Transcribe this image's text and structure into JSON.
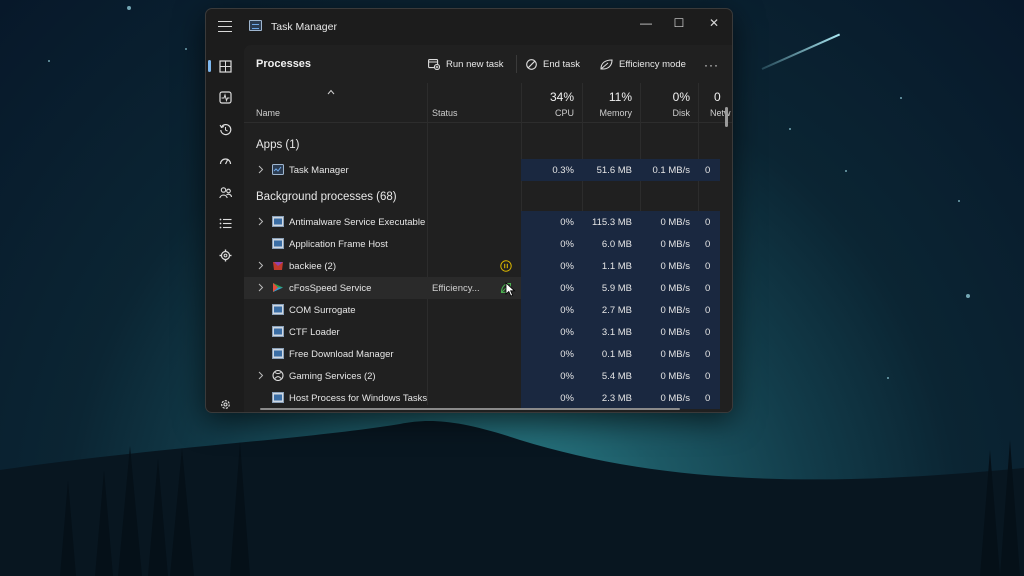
{
  "window": {
    "title": "Task Manager",
    "controls": {
      "minimize": "—",
      "maximize": "☐",
      "close": "✕"
    }
  },
  "sidebar": {
    "items": [
      {
        "icon": "processes-icon",
        "active": true
      },
      {
        "icon": "performance-icon"
      },
      {
        "icon": "app-history-icon"
      },
      {
        "icon": "startup-apps-icon"
      },
      {
        "icon": "users-icon"
      },
      {
        "icon": "details-icon"
      },
      {
        "icon": "services-icon"
      }
    ],
    "settings_icon": "gear-icon"
  },
  "toolbar": {
    "page_title": "Processes",
    "run_new_task": "Run new task",
    "end_task": "End task",
    "efficiency_mode": "Efficiency mode",
    "more": "···"
  },
  "columns": {
    "name": "Name",
    "status": "Status",
    "cpu": {
      "pct": "34%",
      "label": "CPU"
    },
    "memory": {
      "pct": "11%",
      "label": "Memory"
    },
    "disk": {
      "pct": "0%",
      "label": "Disk"
    },
    "network": {
      "pct": "0",
      "label": "Netw"
    }
  },
  "groups": {
    "apps": "Apps (1)",
    "background": "Background processes (68)"
  },
  "apps": [
    {
      "name": "Task Manager",
      "status": "",
      "cpu": "0.3%",
      "memory": "51.6 MB",
      "disk": "0.1 MB/s",
      "network": "0"
    }
  ],
  "background": [
    {
      "name": "Antimalware Service Executable",
      "status": "",
      "cpu": "0%",
      "memory": "115.3 MB",
      "disk": "0 MB/s",
      "network": "0"
    },
    {
      "name": "Application Frame Host",
      "status": "",
      "cpu": "0%",
      "memory": "6.0 MB",
      "disk": "0 MB/s",
      "network": "0"
    },
    {
      "name": "backiee (2)",
      "status": "",
      "cpu": "0%",
      "memory": "1.1 MB",
      "disk": "0 MB/s",
      "network": "0"
    },
    {
      "name": "cFosSpeed Service",
      "status": "Efficiency...",
      "cpu": "0%",
      "memory": "5.9 MB",
      "disk": "0 MB/s",
      "network": "0"
    },
    {
      "name": "COM Surrogate",
      "status": "",
      "cpu": "0%",
      "memory": "2.7 MB",
      "disk": "0 MB/s",
      "network": "0"
    },
    {
      "name": "CTF Loader",
      "status": "",
      "cpu": "0%",
      "memory": "3.1 MB",
      "disk": "0 MB/s",
      "network": "0"
    },
    {
      "name": "Free Download Manager",
      "status": "",
      "cpu": "0%",
      "memory": "0.1 MB",
      "disk": "0 MB/s",
      "network": "0"
    },
    {
      "name": "Gaming Services (2)",
      "status": "",
      "cpu": "0%",
      "memory": "5.4 MB",
      "disk": "0 MB/s",
      "network": "0"
    },
    {
      "name": "Host Process for Windows Tasks",
      "status": "",
      "cpu": "0%",
      "memory": "2.3 MB",
      "disk": "0 MB/s",
      "network": "0"
    }
  ],
  "colors": {
    "window_bg": "#1c1c1c",
    "content_bg": "#202020",
    "metric_highlight": "#1a2840",
    "accent": "#7db8f0",
    "paused": "#d8b400",
    "efficiency": "#4caf50"
  }
}
